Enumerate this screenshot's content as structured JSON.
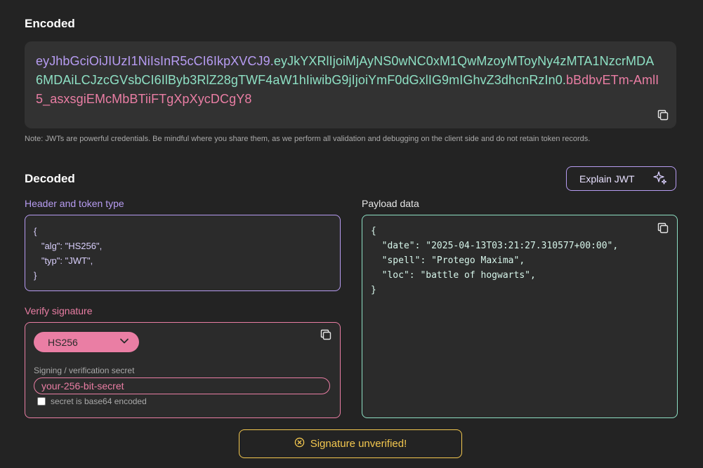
{
  "encoded": {
    "title": "Encoded",
    "token_header": "eyJhbGciOiJIUzI1NiIsInR5cCI6IkpXVCJ9",
    "token_payload": "eyJkYXRlIjoiMjAyNS0wNC0xM1QwMzoyMToyNy4zMTA1NzcrMDA6MDAiLCJzcGVsbCI6IlByb3RlZ28gTWF4aW1hIiwibG9jIjoiYmF0dGxlIG9mIGhvZ3dhcnRzIn0",
    "token_signature": "bBdbvETm-AmlI5_asxsgiEMcMbBTiiFTgXpXycDCgY8",
    "dot": ".",
    "note": "Note: JWTs are powerful credentials. Be mindful where you share them, as we perform all validation and debugging on the client side and do not retain token records.",
    "copy_icon": "copy-icon"
  },
  "decoded": {
    "title": "Decoded",
    "explain_button": "Explain JWT",
    "explain_icon": "sparkle-icon",
    "header": {
      "label": "Header and token type",
      "lines": [
        "{",
        "   \"alg\": \"HS256\",",
        "   \"typ\": \"JWT\",",
        "}"
      ]
    },
    "payload": {
      "label": "Payload data",
      "lines": [
        "{",
        "  \"date\": \"2025-04-13T03:21:27.310577+00:00\",",
        "  \"spell\": \"Protego Maxima\",",
        "  \"loc\": \"battle of hogwarts\",",
        "}"
      ]
    },
    "verify": {
      "label": "Verify signature",
      "algorithm": "HS256",
      "secret_label": "Signing / verification secret",
      "secret_value": "your-256-bit-secret",
      "base64_label": "secret is base64 encoded",
      "base64_checked": false
    },
    "status": {
      "text": "Signature unverified!",
      "icon": "x-circle-icon",
      "color": "#f4c84f"
    }
  },
  "colors": {
    "background": "#232323",
    "header_accent": "#b79cf2",
    "payload_accent": "#8ee0c4",
    "signature_accent": "#ea7ea4",
    "warning": "#f4c84f"
  }
}
